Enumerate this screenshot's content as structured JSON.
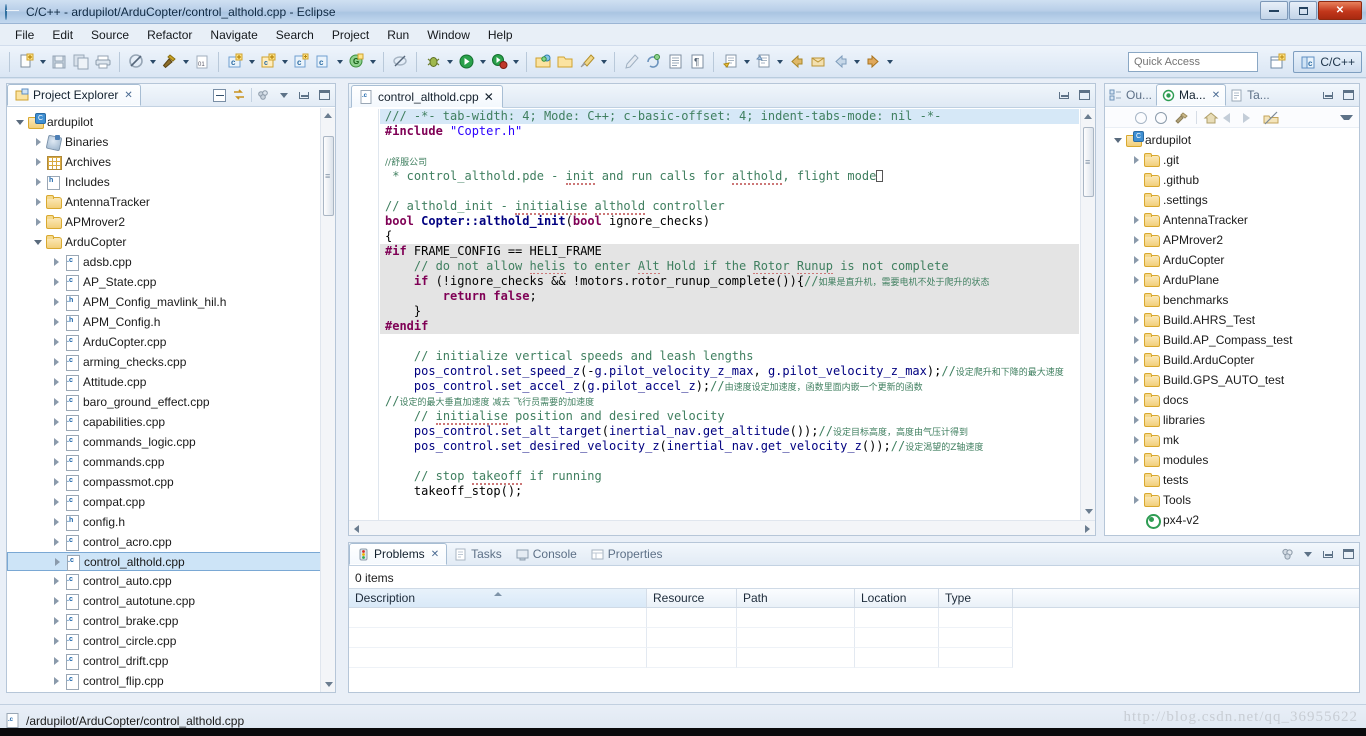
{
  "window": {
    "title": "C/C++ - ardupilot/ArduCopter/control_althold.cpp - Eclipse",
    "app_icon": "eclipse-globe-icon",
    "minimize_label": "Minimize",
    "maximize_label": "Restore",
    "close_label": "✕"
  },
  "menubar": {
    "items": [
      {
        "label": "File"
      },
      {
        "label": "Edit"
      },
      {
        "label": "Source"
      },
      {
        "label": "Refactor"
      },
      {
        "label": "Navigate"
      },
      {
        "label": "Search"
      },
      {
        "label": "Project"
      },
      {
        "label": "Run"
      },
      {
        "label": "Window"
      },
      {
        "label": "Help"
      }
    ]
  },
  "toolbar": {
    "quick_access_placeholder": "Quick Access",
    "perspective_label": "C/C++",
    "icons": [
      "new-file-icon",
      "new-dropdown",
      "save-icon",
      "save-all-icon",
      "print-icon",
      "no-build-icon",
      "build-dropdown",
      "build-hammer-icon",
      "hammer-dropdown",
      "binary-icon",
      "new-c-project-icon",
      "new-c-project-dropdown",
      "new-c-class-icon",
      "new-c-class-dropdown",
      "new-c-source-icon",
      "new-c-source-icon-2",
      "new-c-source-dropdown",
      "new-c-file-icon",
      "new-c-file-dropdown",
      "skip-breakpoints-icon",
      "debug-icon",
      "debug-dropdown",
      "run-icon",
      "run-dropdown",
      "external-tools-icon",
      "external-tools-dropdown",
      "open-resource-icon",
      "open-folder-icon",
      "search-icon",
      "search-dropdown",
      "pencil-icon",
      "refresh-icon",
      "toggle-block-icon",
      "show-whitespace-icon",
      "next-annotation-icon",
      "next-annotation-dropdown",
      "prev-annotation-icon",
      "prev-annotation-dropdown",
      "back-icon",
      "back-dropdown",
      "forward-icon",
      "forward-dropdown",
      "open-perspective-icon"
    ]
  },
  "project_explorer": {
    "tab_label": "Project Explorer",
    "tab_icon": "project-explorer-icon",
    "toolbar_icons": [
      "collapse-all-icon",
      "link-with-editor-icon",
      "view-menu-icon",
      "minimize-icon",
      "maximize-icon"
    ],
    "tree": [
      {
        "label": "ardupilot",
        "indent": 0,
        "twist": "open",
        "icon": "ic-proj"
      },
      {
        "label": "Binaries",
        "indent": 1,
        "twist": "closed",
        "icon": "ic-bin"
      },
      {
        "label": "Archives",
        "indent": 1,
        "twist": "closed",
        "icon": "ic-arch"
      },
      {
        "label": "Includes",
        "indent": 1,
        "twist": "closed",
        "icon": "ic-inc"
      },
      {
        "label": "AntennaTracker",
        "indent": 1,
        "twist": "closed",
        "icon": "ic-folder"
      },
      {
        "label": "APMrover2",
        "indent": 1,
        "twist": "closed",
        "icon": "ic-folder"
      },
      {
        "label": "ArduCopter",
        "indent": 1,
        "twist": "open",
        "icon": "ic-folder"
      },
      {
        "label": "adsb.cpp",
        "indent": 2,
        "twist": "closed",
        "icon": "ic-c"
      },
      {
        "label": "AP_State.cpp",
        "indent": 2,
        "twist": "closed",
        "icon": "ic-c"
      },
      {
        "label": "APM_Config_mavlink_hil.h",
        "indent": 2,
        "twist": "closed",
        "icon": "ic-h"
      },
      {
        "label": "APM_Config.h",
        "indent": 2,
        "twist": "closed",
        "icon": "ic-h"
      },
      {
        "label": "ArduCopter.cpp",
        "indent": 2,
        "twist": "closed",
        "icon": "ic-c"
      },
      {
        "label": "arming_checks.cpp",
        "indent": 2,
        "twist": "closed",
        "icon": "ic-c"
      },
      {
        "label": "Attitude.cpp",
        "indent": 2,
        "twist": "closed",
        "icon": "ic-c"
      },
      {
        "label": "baro_ground_effect.cpp",
        "indent": 2,
        "twist": "closed",
        "icon": "ic-c"
      },
      {
        "label": "capabilities.cpp",
        "indent": 2,
        "twist": "closed",
        "icon": "ic-c"
      },
      {
        "label": "commands_logic.cpp",
        "indent": 2,
        "twist": "closed",
        "icon": "ic-c"
      },
      {
        "label": "commands.cpp",
        "indent": 2,
        "twist": "closed",
        "icon": "ic-c"
      },
      {
        "label": "compassmot.cpp",
        "indent": 2,
        "twist": "closed",
        "icon": "ic-c"
      },
      {
        "label": "compat.cpp",
        "indent": 2,
        "twist": "closed",
        "icon": "ic-c"
      },
      {
        "label": "config.h",
        "indent": 2,
        "twist": "closed",
        "icon": "ic-h"
      },
      {
        "label": "control_acro.cpp",
        "indent": 2,
        "twist": "closed",
        "icon": "ic-c"
      },
      {
        "label": "control_althold.cpp",
        "indent": 2,
        "twist": "closed",
        "icon": "ic-c",
        "selected": true
      },
      {
        "label": "control_auto.cpp",
        "indent": 2,
        "twist": "closed",
        "icon": "ic-c"
      },
      {
        "label": "control_autotune.cpp",
        "indent": 2,
        "twist": "closed",
        "icon": "ic-c"
      },
      {
        "label": "control_brake.cpp",
        "indent": 2,
        "twist": "closed",
        "icon": "ic-c"
      },
      {
        "label": "control_circle.cpp",
        "indent": 2,
        "twist": "closed",
        "icon": "ic-c"
      },
      {
        "label": "control_drift.cpp",
        "indent": 2,
        "twist": "closed",
        "icon": "ic-c"
      },
      {
        "label": "control_flip.cpp",
        "indent": 2,
        "twist": "closed",
        "icon": "ic-c"
      }
    ]
  },
  "editor": {
    "tab_label": "control_althold.cpp",
    "tab_icon": "c-source-icon",
    "minimize_label": "Minimize",
    "maximize_label": "Maximize",
    "lines": [
      {
        "html": "<span class='cm'>/// -*- tab-width: 4; Mode: C++; c-basic-offset: 4; indent-tabs-mode: nil -*-</span>",
        "style": "sel"
      },
      {
        "html": "<span class='pp'>#include</span> <span class='str'>\"Copter.h\"</span>",
        "style": ""
      },
      {
        "html": "",
        "style": ""
      },
      {
        "html": "<span class='cm cjk'>//舒服公司</span>",
        "style": ""
      },
      {
        "html": "<span class='cm'> * control_althold.pde - <span class='squig'>init</span> and run calls for <span class='squig'>althold</span>, flight mode</span><span class='caretbox'></span>",
        "style": "",
        "fold": "+"
      },
      {
        "html": "",
        "style": ""
      },
      {
        "html": "<span class='cm'>// althold_init - <span class='squig'>initialise</span> <span class='squig'>althold</span> controller</span>",
        "style": ""
      },
      {
        "html": "<span class='kw'>bool</span> <span class='blue'><b>Copter::althold_init</b></span>(<span class='kw'>bool</span> ignore_checks)",
        "style": "",
        "fold": "-"
      },
      {
        "html": "{",
        "style": ""
      },
      {
        "html": "<span class='pp'>#if</span> FRAME_CONFIG == HELI_FRAME",
        "style": "hl"
      },
      {
        "html": "    <span class='cm'>// do not allow <span class='squig'>helis</span> to enter <span class='squig'>Alt</span> Hold if the <span class='squig'>Rotor</span> <span class='squig'>Runup</span> is not complete</span>",
        "style": "hl"
      },
      {
        "html": "    <span class='kw'>if</span> (!ignore_checks &amp;&amp; !motors.rotor_runup_complete()){<span class='cm'>//</span><span class='cjk'>如果是直升机，需要电机不处于爬升的状态</span>",
        "style": "hl"
      },
      {
        "html": "        <span class='kw'>return</span> <span class='kw'>false</span>;",
        "style": "hl"
      },
      {
        "html": "    }",
        "style": "hl"
      },
      {
        "html": "<span class='pp'>#endif</span>",
        "style": "hl"
      },
      {
        "html": "",
        "style": ""
      },
      {
        "html": "    <span class='cm'>// initialize vertical speeds and leash lengths</span>",
        "style": ""
      },
      {
        "html": "    <span class='blue'>pos_control.set_speed_z</span>(-<span class='blue'>g.pilot_velocity_z_max</span>, <span class='blue'>g.pilot_velocity_z_max</span>);<span class='cm'>//</span><span class='cjk'>设定爬升和下降的最大速度</span>",
        "style": ""
      },
      {
        "html": "    <span class='blue'>pos_control.set_accel_z</span>(<span class='blue'>g.pilot_accel_z</span>);<span class='cm'>//</span><span class='cjk'>由速度设定加速度，函数里面内嵌一个更新的函数</span>",
        "style": ""
      },
      {
        "html": "<span class='cm'>//</span><span class='cjk'>设定的最大垂直加速度 减去 飞行员需要的加速度</span>",
        "style": ""
      },
      {
        "html": "    <span class='cm'>// <span class='squig'>initialise</span> position and desired velocity</span>",
        "style": ""
      },
      {
        "html": "    <span class='blue'>pos_control.set_alt_target</span>(<span class='blue'>inertial_nav.get_altitude</span>());<span class='cm'>//</span><span class='cjk'>设定目标高度，高度由气压计得到</span>",
        "style": ""
      },
      {
        "html": "    <span class='blue'>pos_control.set_desired_velocity_z</span>(<span class='blue'>inertial_nav.get_velocity_z</span>());<span class='cm'>//</span><span class='cjk'>设定渴望的Z轴速度</span>",
        "style": ""
      },
      {
        "html": "",
        "style": ""
      },
      {
        "html": "    <span class='cm'>// stop <span class='squig'>takeoff</span> if running</span>",
        "style": ""
      },
      {
        "html": "    takeoff_stop();",
        "style": ""
      }
    ]
  },
  "right_panel": {
    "tabs": [
      {
        "label": "Ou...",
        "icon": "outline-icon",
        "active": false
      },
      {
        "label": "Ma...",
        "icon": "make-target-icon",
        "active": true
      },
      {
        "label": "Ta...",
        "icon": "tasks-icon",
        "active": false
      }
    ],
    "toolbar_icons": [
      "build-target-icon",
      "build-target-2-icon",
      "build-target-3-icon",
      "home-icon",
      "back-icon",
      "forward-icon",
      "hide-icon",
      "view-menu-icon"
    ],
    "tree": [
      {
        "label": "ardupilot",
        "indent": 0,
        "twist": "open",
        "icon": "ic-proj"
      },
      {
        "label": ".git",
        "indent": 1,
        "twist": "closed",
        "icon": "ic-folder"
      },
      {
        "label": ".github",
        "indent": 1,
        "twist": "none",
        "icon": "ic-folder"
      },
      {
        "label": ".settings",
        "indent": 1,
        "twist": "none",
        "icon": "ic-folder"
      },
      {
        "label": "AntennaTracker",
        "indent": 1,
        "twist": "closed",
        "icon": "ic-folder"
      },
      {
        "label": "APMrover2",
        "indent": 1,
        "twist": "closed",
        "icon": "ic-folder"
      },
      {
        "label": "ArduCopter",
        "indent": 1,
        "twist": "closed",
        "icon": "ic-folder"
      },
      {
        "label": "ArduPlane",
        "indent": 1,
        "twist": "closed",
        "icon": "ic-folder"
      },
      {
        "label": "benchmarks",
        "indent": 1,
        "twist": "none",
        "icon": "ic-folder"
      },
      {
        "label": "Build.AHRS_Test",
        "indent": 1,
        "twist": "closed",
        "icon": "ic-folder"
      },
      {
        "label": "Build.AP_Compass_test",
        "indent": 1,
        "twist": "closed",
        "icon": "ic-folder"
      },
      {
        "label": "Build.ArduCopter",
        "indent": 1,
        "twist": "closed",
        "icon": "ic-folder"
      },
      {
        "label": "Build.GPS_AUTO_test",
        "indent": 1,
        "twist": "closed",
        "icon": "ic-folder"
      },
      {
        "label": "docs",
        "indent": 1,
        "twist": "closed",
        "icon": "ic-folder"
      },
      {
        "label": "libraries",
        "indent": 1,
        "twist": "closed",
        "icon": "ic-folder"
      },
      {
        "label": "mk",
        "indent": 1,
        "twist": "closed",
        "icon": "ic-folder"
      },
      {
        "label": "modules",
        "indent": 1,
        "twist": "closed",
        "icon": "ic-folder"
      },
      {
        "label": "tests",
        "indent": 1,
        "twist": "none",
        "icon": "ic-folder"
      },
      {
        "label": "Tools",
        "indent": 1,
        "twist": "closed",
        "icon": "ic-folder"
      },
      {
        "label": "px4-v2",
        "indent": 1,
        "twist": "none",
        "icon": "ic-target"
      }
    ]
  },
  "problems_panel": {
    "tabs": [
      {
        "label": "Problems",
        "icon": "problems-icon",
        "active": true
      },
      {
        "label": "Tasks",
        "icon": "tasks-icon",
        "active": false
      },
      {
        "label": "Console",
        "icon": "console-icon",
        "active": false
      },
      {
        "label": "Properties",
        "icon": "properties-icon",
        "active": false
      }
    ],
    "items_count": "0 items",
    "columns": [
      "Description",
      "Resource",
      "Path",
      "Location",
      "Type"
    ],
    "rows": [],
    "toolbar_icons": [
      "filters-icon",
      "view-menu-icon",
      "minimize-icon",
      "maximize-icon"
    ]
  },
  "statusbar": {
    "icon": "c-source-icon",
    "path": "/ardupilot/ArduCopter/control_althold.cpp",
    "watermark": "http://blog.csdn.net/qq_36955622"
  },
  "colors": {
    "accent": "#3f8fd2",
    "selection": "#cde4f7",
    "comment": "#3f7f5f",
    "keyword": "#7f0055",
    "string": "#2a00ff",
    "highlight_block": "#e4e4e4"
  }
}
